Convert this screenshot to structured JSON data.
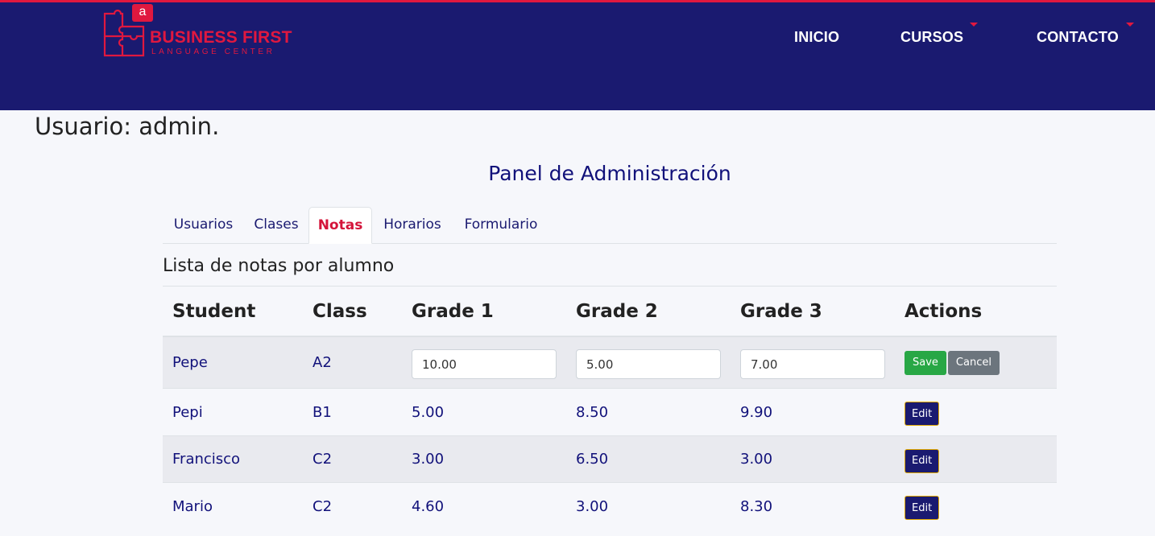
{
  "header": {
    "logo": {
      "badge": "a",
      "name": "BUSINESS FIRST",
      "tagline": "LANGUAGE CENTER"
    },
    "nav": [
      {
        "label": "INICIO",
        "dropdown": false
      },
      {
        "label": "CURSOS",
        "dropdown": true
      },
      {
        "label": "CONTACTO",
        "dropdown": true
      }
    ]
  },
  "user_heading": "Usuario: admin.",
  "panel_title": "Panel de Administración",
  "tabs": [
    {
      "label": "Usuarios",
      "active": false
    },
    {
      "label": "Clases",
      "active": false
    },
    {
      "label": "Notas",
      "active": true
    },
    {
      "label": "Horarios",
      "active": false
    },
    {
      "label": "Formulario",
      "active": false
    }
  ],
  "section_title": "Lista de notas por alumno",
  "table": {
    "headers": [
      "Student",
      "Class",
      "Grade 1",
      "Grade 2",
      "Grade 3",
      "Actions"
    ],
    "rows": [
      {
        "student": "Pepe",
        "class": "A2",
        "grade1": "10.00",
        "grade2": "5.00",
        "grade3": "7.00",
        "editing": true
      },
      {
        "student": "Pepi",
        "class": "B1",
        "grade1": "5.00",
        "grade2": "8.50",
        "grade3": "9.90",
        "editing": false
      },
      {
        "student": "Francisco",
        "class": "C2",
        "grade1": "3.00",
        "grade2": "6.50",
        "grade3": "3.00",
        "editing": false
      },
      {
        "student": "Mario",
        "class": "C2",
        "grade1": "4.60",
        "grade2": "3.00",
        "grade3": "8.30",
        "editing": false
      }
    ],
    "actions": {
      "save": "Save",
      "cancel": "Cancel",
      "edit": "Edit"
    }
  },
  "colors": {
    "navbar": "#1a1a70",
    "accent": "#e0183f",
    "save": "#28a745",
    "cancel": "#6c757d"
  }
}
